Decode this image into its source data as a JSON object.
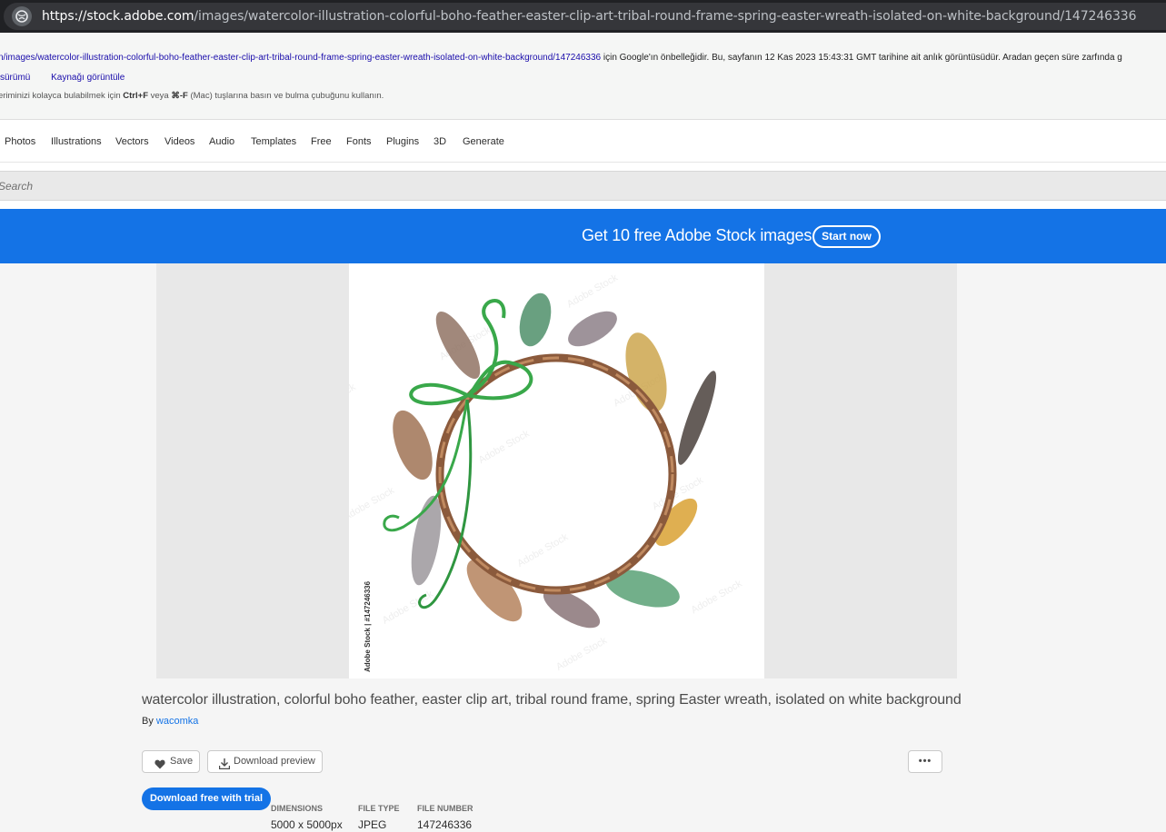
{
  "browser": {
    "url_host": "https://stock.adobe.com",
    "url_path": "/images/watercolor-illustration-colorful-boho-feather-easter-clip-art-tribal-round-frame-spring-easter-wreath-isolated-on-white-background/147246336"
  },
  "cache_notice": {
    "url_text": "n/images/watercolor-illustration-colorful-boho-feather-easter-clip-art-tribal-round-frame-spring-easter-wreath-isolated-on-white-background/147246336",
    "message": " için Google'ın önbelleğidir. Bu, sayfanın 12 Kas 2023 15:43:31 GMT tarihine ait anlık görüntüsüdür. Aradan geçen süre zarfında g",
    "link_text_version": "sürümü",
    "link_view_source": "Kaynağı görüntüle",
    "hint_prefix": "eriminizi kolayca bulabilmek için ",
    "hint_key1": "Ctrl+F",
    "hint_mid": " veya ",
    "hint_key2": "⌘-F",
    "hint_suffix": " (Mac) tuşlarına basın ve bulma çubuğunu kullanın."
  },
  "nav": {
    "items": [
      "Photos",
      "Illustrations",
      "Vectors",
      "Videos",
      "Audio",
      "Templates",
      "Free",
      "Fonts",
      "Plugins",
      "3D",
      "Generate"
    ]
  },
  "search": {
    "placeholder": "Search"
  },
  "promo": {
    "text": "Get 10 free Adobe Stock images.",
    "button": "Start now"
  },
  "asset": {
    "watermark": "Adobe Stock | #147246336",
    "title": "watercolor illustration, colorful boho feather, easter clip art, tribal round frame, spring Easter wreath, isolated on white background",
    "by_label": "By ",
    "author": "wacomka",
    "save_label": "Save",
    "download_preview_label": "Download preview",
    "more_label": "•••",
    "primary_cta": "Download free with trial",
    "meta": [
      {
        "key": "DIMENSIONS",
        "value": "5000 x 5000px"
      },
      {
        "key": "FILE TYPE",
        "value": "JPEG"
      },
      {
        "key": "FILE NUMBER",
        "value": "147246336"
      }
    ]
  },
  "colors": {
    "brand_blue": "#1473e6",
    "browser_bar": "#202124"
  }
}
